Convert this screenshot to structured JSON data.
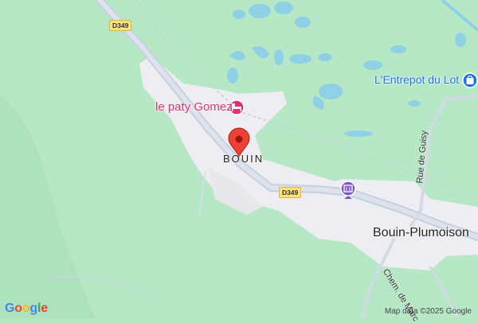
{
  "map": {
    "place_label": "BOUIN",
    "town_label": "Bouin-Plumoison",
    "poi_hotel": "le paty Gomez",
    "poi_store": "L'Entrepot du Lot",
    "road_label_1": "D349",
    "road_label_2": "D349",
    "street_label_1": "Rue de Guisy",
    "street_label_2": "Chem. de Marc",
    "copyright": "Map data ©2025 Google",
    "logo": "Google",
    "colors": {
      "land_green": "#b6e8c6",
      "urban": "#eeeef2",
      "water": "#8ed1e6",
      "road": "#cfd6e2",
      "marker": "#ea4335",
      "hotel_pink": "#e2306d",
      "store_blue": "#1a73e8",
      "museum_purple": "#7e57c2"
    },
    "icons": {
      "marker": "location-pin-icon",
      "hotel": "bed-icon",
      "store": "shopping-bag-icon",
      "museum": "museum-icon"
    }
  }
}
